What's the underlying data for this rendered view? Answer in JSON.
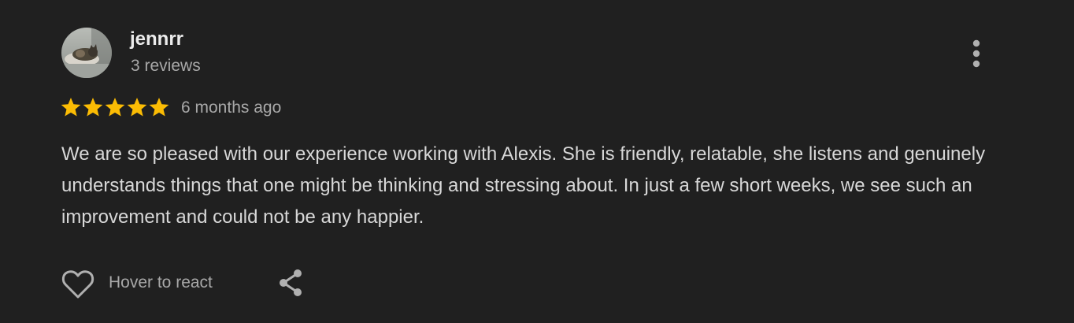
{
  "review": {
    "author": {
      "name": "jennrr",
      "review_count": "3 reviews"
    },
    "rating": 5,
    "rating_max": 5,
    "date": "6 months ago",
    "text": "We are so pleased with our experience working with Alexis. She is friendly, relatable, she listens and genuinely understands things that one might be thinking and stressing about. In just a few short weeks, we see such an improvement and could not be any happier.",
    "actions": {
      "like_label": "Hover to react"
    }
  },
  "icons": {
    "more": "more-vert-icon",
    "star": "star-icon",
    "heart": "heart-icon",
    "share": "share-icon"
  },
  "colors": {
    "background": "#202020",
    "star": "#fbbc04",
    "primary_text": "#ececec",
    "secondary_text": "#a8a8a8",
    "icon": "#b0b0b0"
  }
}
